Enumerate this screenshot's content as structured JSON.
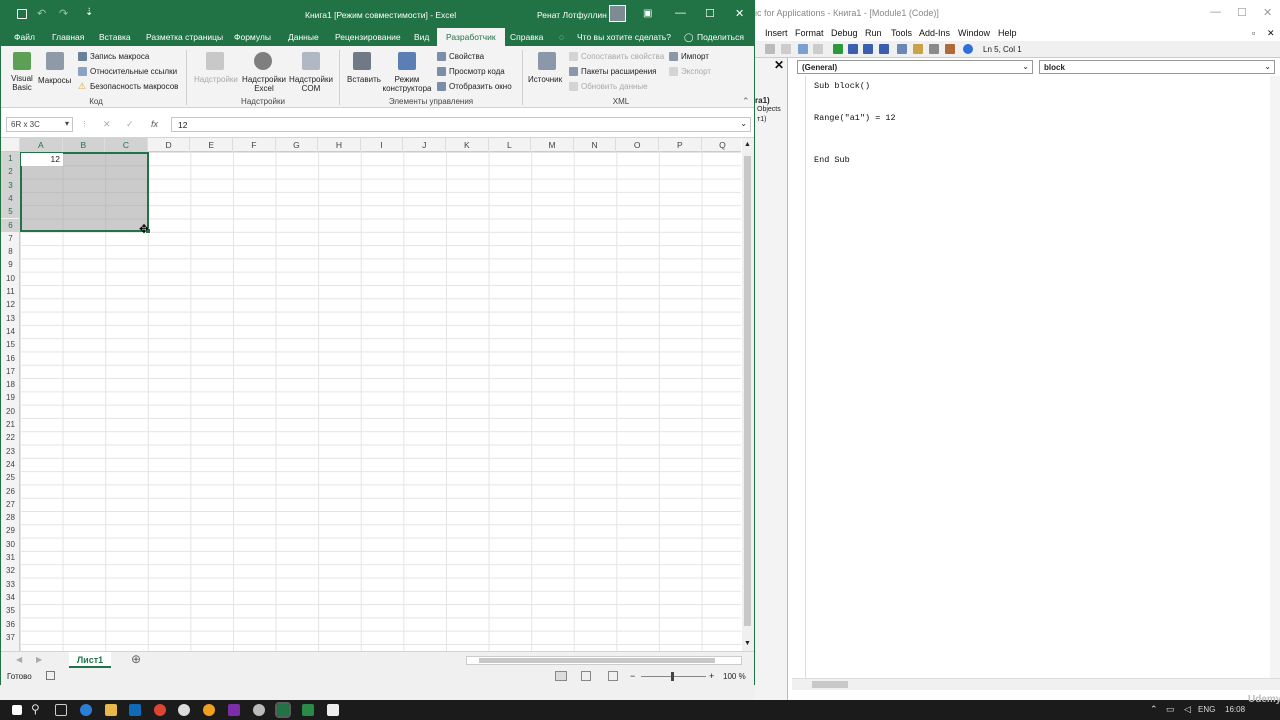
{
  "excel": {
    "title": "Книга1  [Режим совместимости]  -  Excel",
    "user": "Ренат Лотфуллин",
    "tabs": [
      "Файл",
      "Главная",
      "Вставка",
      "Разметка страницы",
      "Формулы",
      "Данные",
      "Рецензирование",
      "Вид",
      "Разработчик",
      "Справка",
      "Что вы хотите сделать?",
      "Поделиться"
    ],
    "ribbon": {
      "code": {
        "visual_basic": "Visual Basic",
        "macros": "Макросы",
        "record": "Запись макроса",
        "relative": "Относительные ссылки",
        "security": "Безопасность макросов",
        "group": "Код"
      },
      "addins": {
        "addins": "Надстройки",
        "excel_addins": "Надстройки Excel",
        "com_addins": "Надстройки COM",
        "group": "Надстройки"
      },
      "controls": {
        "insert": "Вставить",
        "design_mode": "Режим конструктора",
        "properties": "Свойства",
        "view_code": "Просмотр кода",
        "run_dialog": "Отобразить окно",
        "group": "Элементы управления"
      },
      "xml": {
        "source": "Источник",
        "map_props": "Сопоставить свойства",
        "packs": "Пакеты расширения",
        "refresh": "Обновить данные",
        "import": "Импорт",
        "export": "Экспорт",
        "group": "XML"
      }
    },
    "name_box": "6R x 3C",
    "formula": "12",
    "fx": "fx",
    "columns": [
      "A",
      "B",
      "C",
      "D",
      "E",
      "F",
      "G",
      "H",
      "I",
      "J",
      "K",
      "L",
      "M",
      "N",
      "O",
      "P",
      "Q"
    ],
    "rows": [
      "1",
      "2",
      "3",
      "4",
      "5",
      "6",
      "7",
      "8",
      "9",
      "10",
      "11",
      "12",
      "13",
      "14",
      "15",
      "16",
      "17",
      "18",
      "19",
      "20",
      "21",
      "22",
      "23",
      "24",
      "25",
      "26",
      "27",
      "28",
      "29",
      "30",
      "31",
      "32",
      "33",
      "34",
      "35",
      "36",
      "37"
    ],
    "cell_a1": "12",
    "sheet_tab": "Лист1",
    "status": "Готово",
    "zoom": "100 %"
  },
  "vba": {
    "title": "ic for Applications - Книга1 - [Module1 (Code)]",
    "menu": [
      "Insert",
      "Format",
      "Debug",
      "Run",
      "Tools",
      "Add-Ins",
      "Window",
      "Help"
    ],
    "position": "Ln 5, Col 1",
    "object_dd": "(General)",
    "proc_dd": "block",
    "project_fragments": [
      "ra1)",
      "Objects",
      "т1)"
    ],
    "code": [
      "Sub block()",
      "Range(\"a1\") = 12",
      "End Sub"
    ]
  },
  "taskbar": {
    "lang": "ENG",
    "time": "16:08",
    "watermark": "Udemy"
  }
}
